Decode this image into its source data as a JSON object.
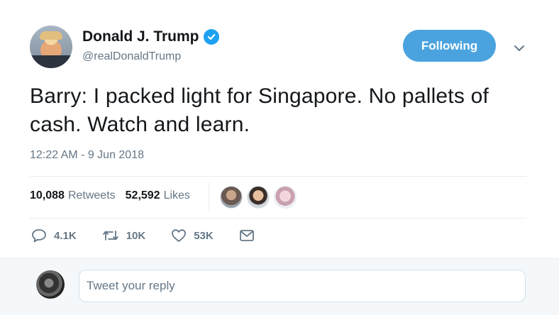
{
  "author": {
    "display_name": "Donald J. Trump",
    "handle": "@realDonaldTrump",
    "verified": true
  },
  "follow_button": {
    "label": "Following"
  },
  "tweet": {
    "text": "Barry: I packed light for Singapore. No pallets of cash. Watch and learn.",
    "timestamp": "12:22 AM - 9 Jun 2018"
  },
  "stats": {
    "retweets_count": "10,088",
    "retweets_label": "Retweets",
    "likes_count": "52,592",
    "likes_label": "Likes"
  },
  "actions": {
    "reply_count": "4.1K",
    "retweet_count": "10K",
    "like_count": "53K"
  },
  "reply": {
    "placeholder": "Tweet your reply"
  },
  "colors": {
    "accent": "#1da1f2",
    "follow_bg": "#4aa3df",
    "muted_text": "#657786",
    "divider": "#e6ecf0"
  },
  "icons": [
    "verified-badge-icon",
    "chevron-down-icon",
    "reply-icon",
    "retweet-icon",
    "heart-icon",
    "envelope-icon"
  ]
}
